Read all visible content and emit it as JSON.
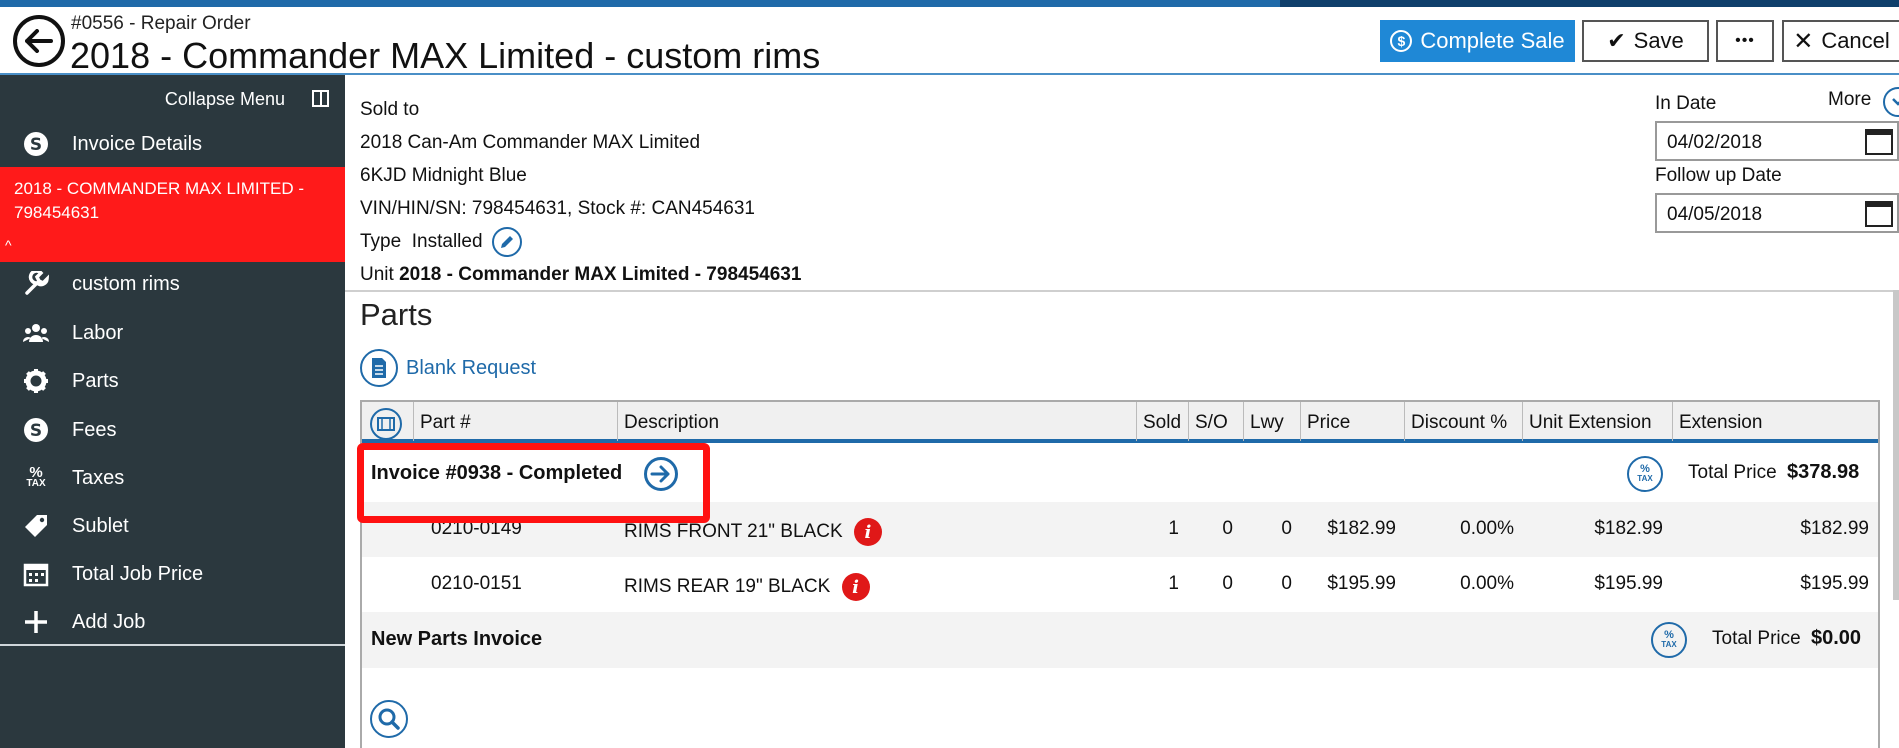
{
  "header": {
    "ro_label": "#0556 - Repair Order",
    "title": "2018 - Commander MAX Limited - custom rims",
    "complete_sale": "Complete Sale",
    "save": "Save",
    "more_dots": "•••",
    "cancel": "Cancel"
  },
  "sidebar": {
    "collapse": "Collapse Menu",
    "invoice_details": "Invoice Details",
    "unit": "2018 - COMMANDER MAX LIMITED - 798454631",
    "items": [
      "custom rims",
      "Labor",
      "Parts",
      "Fees",
      "Taxes",
      "Sublet",
      "Total Job Price",
      "Add Job"
    ]
  },
  "sold_to": {
    "label": "Sold to",
    "line1": "2018 Can-Am Commander MAX Limited",
    "line2": "6KJD Midnight Blue",
    "line3": "VIN/HIN/SN: 798454631, Stock #: CAN454631",
    "type_label": "Type",
    "type_value": "Installed",
    "unit_label": "Unit",
    "unit_value": "2018 - Commander MAX Limited - 798454631"
  },
  "dates": {
    "more": "More",
    "in_label": "In Date",
    "in_value": "04/02/2018",
    "follow_label": "Follow up Date",
    "follow_value": "04/05/2018"
  },
  "parts": {
    "title": "Parts",
    "blank_request": "Blank Request",
    "columns": [
      "Part #",
      "Description",
      "Sold",
      "S/O",
      "Lwy",
      "Price",
      "Discount %",
      "Unit Extension",
      "Extension"
    ],
    "invoice": {
      "title": "Invoice #0938 - Completed",
      "total_label": "Total Price",
      "total_value": "$378.98",
      "rows": [
        {
          "part": "0210-0149",
          "desc": "RIMS FRONT 21\" BLACK",
          "sold": "1",
          "so": "0",
          "lwy": "0",
          "price": "$182.99",
          "disc": "0.00%",
          "unit_ext": "$182.99",
          "ext": "$182.99"
        },
        {
          "part": "0210-0151",
          "desc": "RIMS REAR 19\" BLACK",
          "sold": "1",
          "so": "0",
          "lwy": "0",
          "price": "$195.99",
          "disc": "0.00%",
          "unit_ext": "$195.99",
          "ext": "$195.99"
        }
      ]
    },
    "new_invoice": {
      "title": "New Parts Invoice",
      "total_label": "Total Price",
      "total_value": "$0.00"
    },
    "tax_icon_pct": "%",
    "tax_icon_txt": "TAX"
  },
  "colors": {
    "accent": "#1f6aa9",
    "primary_button": "#1f88d6",
    "sidebar": "#2b383e",
    "selected": "#ff1a1a",
    "highlight": "#ff1111"
  }
}
